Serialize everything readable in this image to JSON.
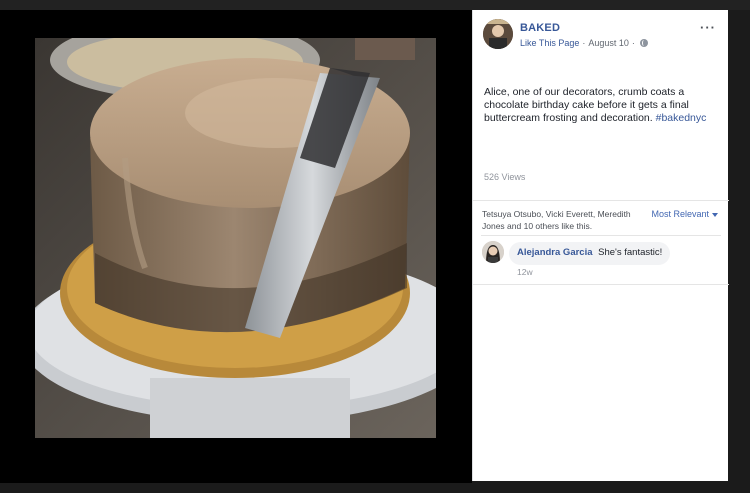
{
  "post": {
    "page_name": "BAKED",
    "like_page_label": "Like This Page",
    "separator": "·",
    "date": "August 10",
    "separator2": "·",
    "more_label": "···",
    "text": "Alice, one of our decorators, crumb coats a chocolate birthday cake before it gets a final buttercream frosting and decoration.",
    "hashtag": "#bakednyc",
    "views": "526 Views"
  },
  "reactions": {
    "likers": "Tetsuya Otsubo, Vicki Everett, Meredith Jones and 10 others like this.",
    "sort_label": "Most Relevant"
  },
  "comments": [
    {
      "author": "Alejandra Garcia",
      "text": "She's fantastic!",
      "time": "12w"
    }
  ],
  "icons": {
    "globe": "globe-icon",
    "sort_caret": "chevron-down-icon"
  },
  "colors": {
    "link": "#385898",
    "sort_link": "#4267b2",
    "stage": "#000000"
  }
}
